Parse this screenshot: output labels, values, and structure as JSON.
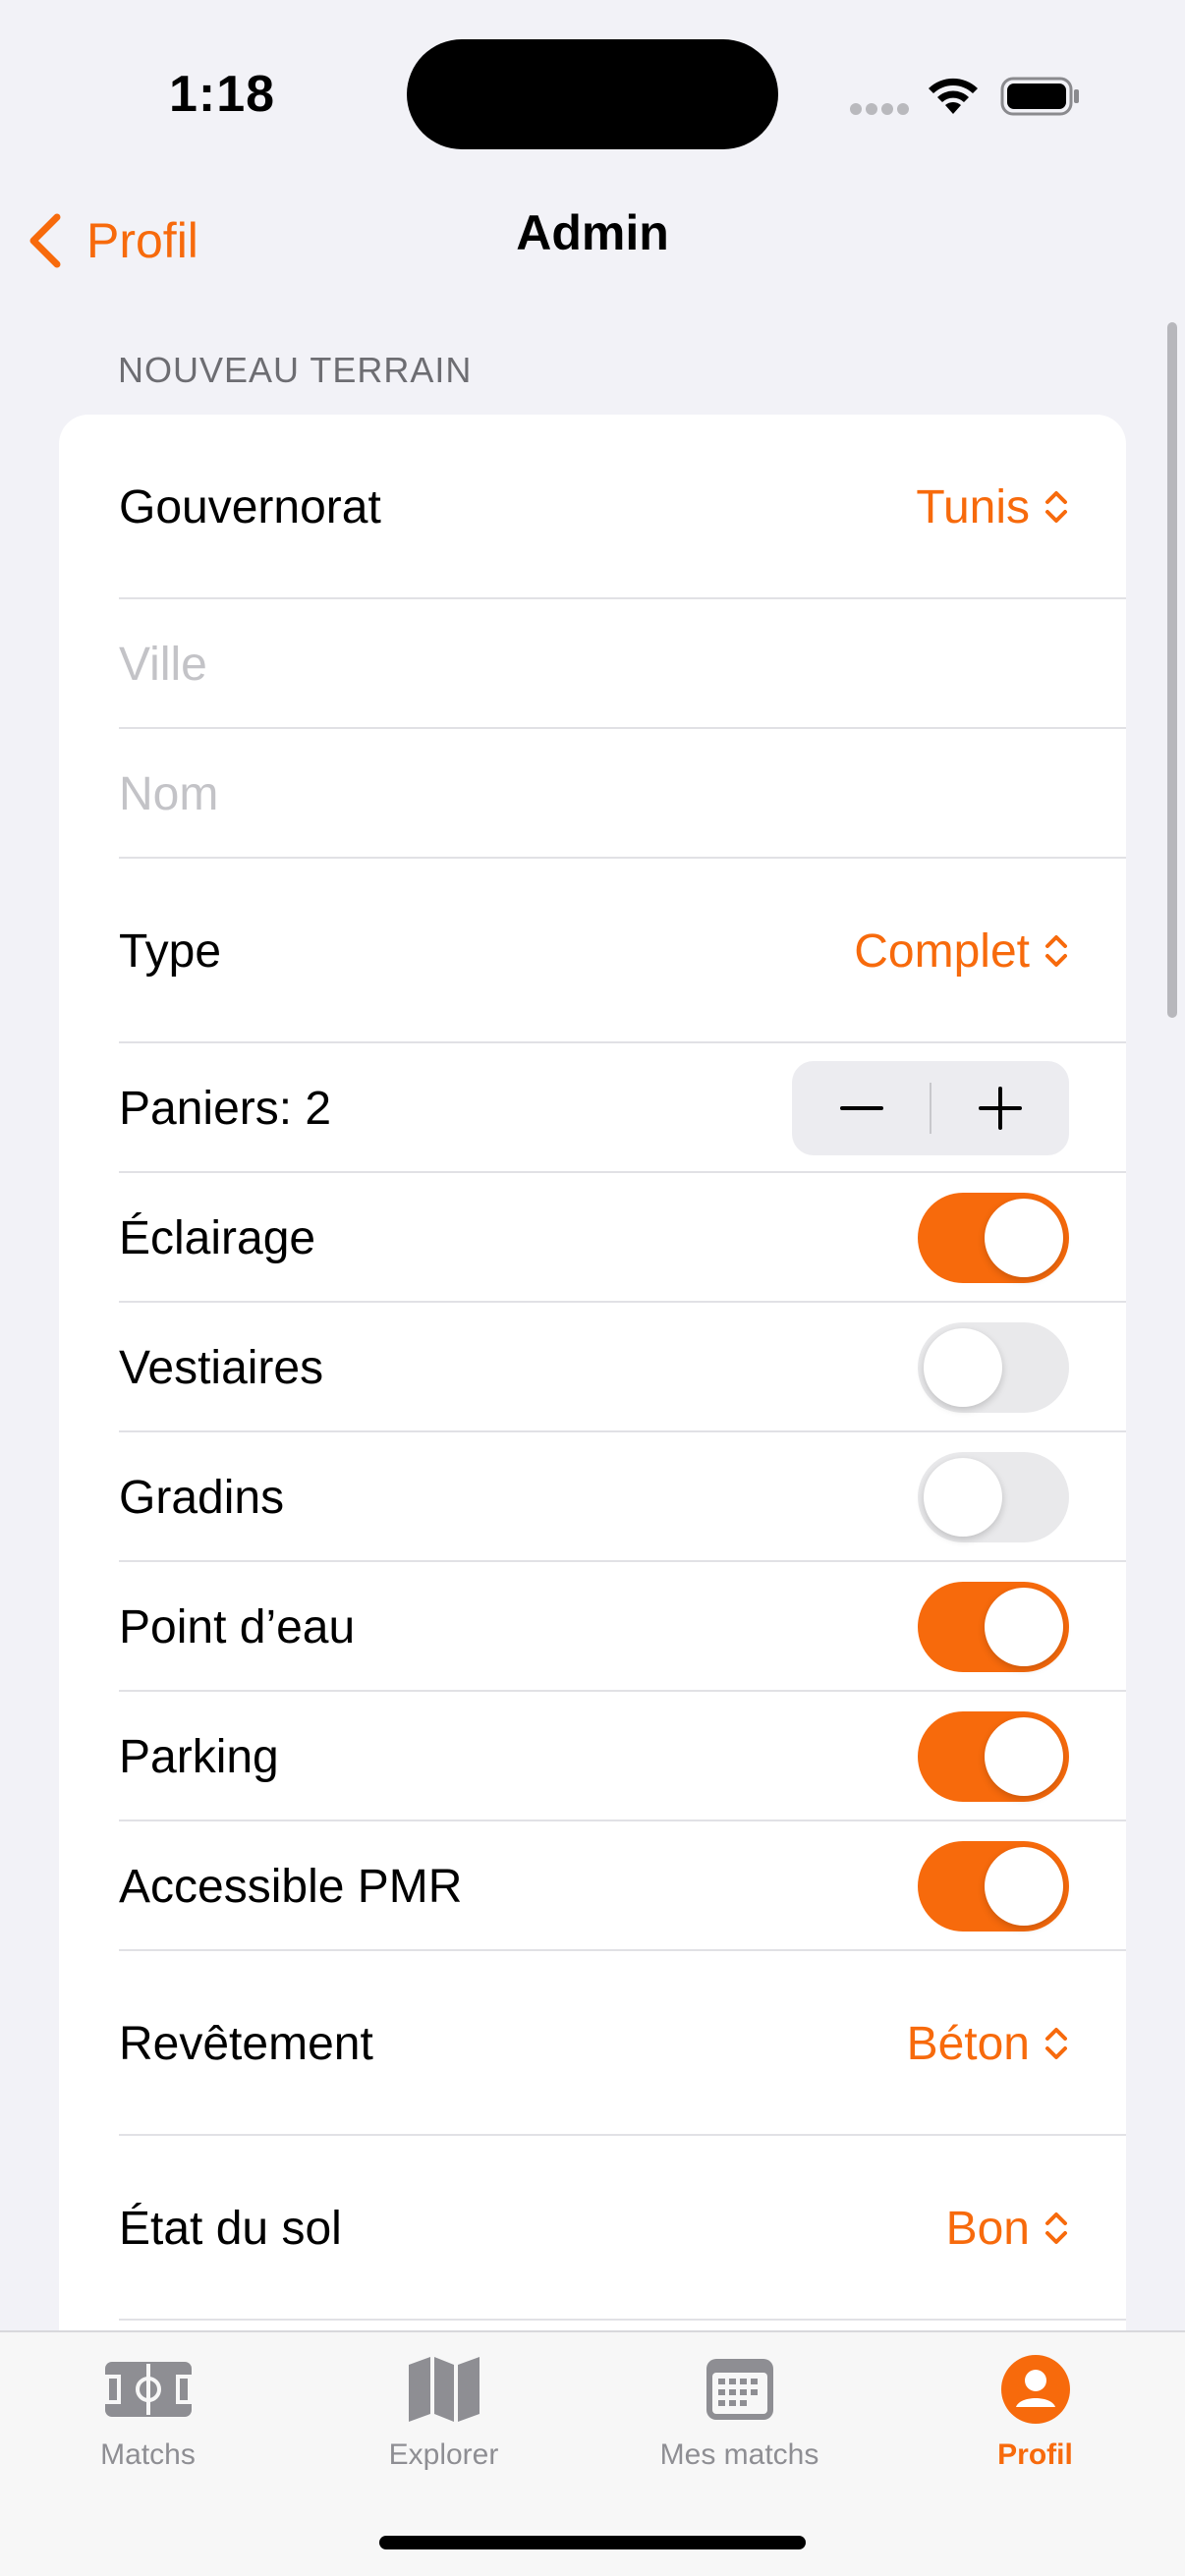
{
  "status_bar": {
    "time": "1:18"
  },
  "nav": {
    "back_label": "Profil",
    "title": "Admin"
  },
  "section": {
    "header": "NOUVEAU TERRAIN"
  },
  "form": {
    "gouvernorat": {
      "label": "Gouvernorat",
      "value": "Tunis"
    },
    "ville": {
      "placeholder": "Ville",
      "value": ""
    },
    "nom": {
      "placeholder": "Nom",
      "value": ""
    },
    "type": {
      "label": "Type",
      "value": "Complet"
    },
    "paniers": {
      "label": "Paniers: 2",
      "count": 2,
      "minus": "−",
      "plus": "+"
    },
    "toggles": [
      {
        "label": "Éclairage",
        "on": true
      },
      {
        "label": "Vestiaires",
        "on": false
      },
      {
        "label": "Gradins",
        "on": false
      },
      {
        "label": "Point d’eau",
        "on": true
      },
      {
        "label": "Parking",
        "on": true
      },
      {
        "label": "Accessible PMR",
        "on": true
      }
    ],
    "revetement": {
      "label": "Revêtement",
      "value": "Béton"
    },
    "etat_sol": {
      "label": "État du sol",
      "value": "Bon"
    }
  },
  "tab_bar": {
    "tabs": [
      {
        "label": "Matchs",
        "icon": "pitch-icon",
        "active": false
      },
      {
        "label": "Explorer",
        "icon": "map-icon",
        "active": false
      },
      {
        "label": "Mes matchs",
        "icon": "calendar-icon",
        "active": false
      },
      {
        "label": "Profil",
        "icon": "person-icon",
        "active": true
      }
    ]
  },
  "colors": {
    "accent": "#f76a0c",
    "background": "#f2f2f7",
    "inactive": "#8e8e93"
  }
}
